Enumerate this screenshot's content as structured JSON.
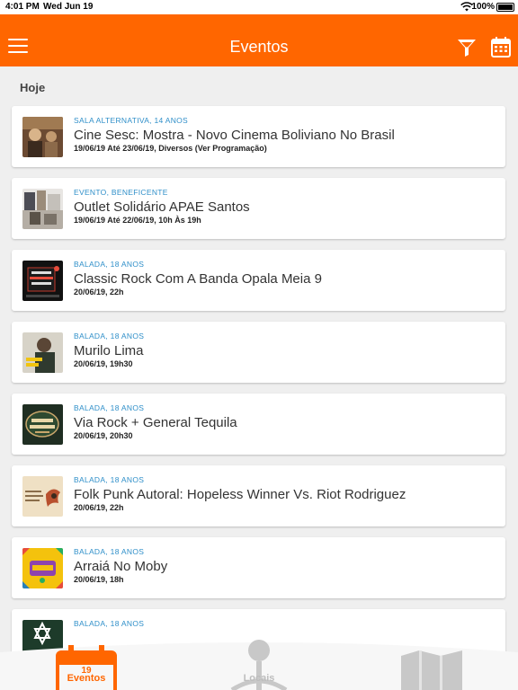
{
  "status_bar": {
    "time": "4:01 PM",
    "date": "Wed Jun 19",
    "battery": "100%"
  },
  "app_bar": {
    "title": "Eventos",
    "color": "#ff6600"
  },
  "section_title": "Hoje",
  "events": [
    {
      "category": "SALA ALTERNATIVA, 14 ANOS",
      "title": "Cine Sesc: Mostra - Novo Cinema Boliviano No Brasil",
      "date": "19/06/19 Até 23/06/19, Diversos (Ver Programação)"
    },
    {
      "category": "EVENTO, BENEFICENTE",
      "title": "Outlet Solidário APAE Santos",
      "date": "19/06/19 Até 22/06/19, 10h Às 19h"
    },
    {
      "category": "BALADA, 18 ANOS",
      "title": "Classic Rock Com A Banda Opala Meia 9",
      "date": "20/06/19, 22h"
    },
    {
      "category": "BALADA, 18 ANOS",
      "title": "Murilo Lima",
      "date": "20/06/19, 19h30"
    },
    {
      "category": "BALADA, 18 ANOS",
      "title": "Via Rock + General Tequila",
      "date": "20/06/19, 20h30"
    },
    {
      "category": "BALADA, 18 ANOS",
      "title": "Folk Punk Autoral: Hopeless Winner Vs. Riot Rodriguez",
      "date": "20/06/19, 22h"
    },
    {
      "category": "BALADA, 18 ANOS",
      "title": "Arraiá No Moby",
      "date": "20/06/19, 18h"
    },
    {
      "category": "BALADA, 18 ANOS",
      "title": "",
      "date": ""
    }
  ],
  "tabs": [
    {
      "label": "Eventos",
      "icon": "calendar-icon",
      "badge": "19",
      "active": true
    },
    {
      "label": "Locais",
      "icon": "map-pin-icon",
      "active": false
    },
    {
      "label": "",
      "icon": "map-icon",
      "active": false
    }
  ],
  "colors": {
    "accent": "#ff6600",
    "category": "#2f8fc9"
  }
}
